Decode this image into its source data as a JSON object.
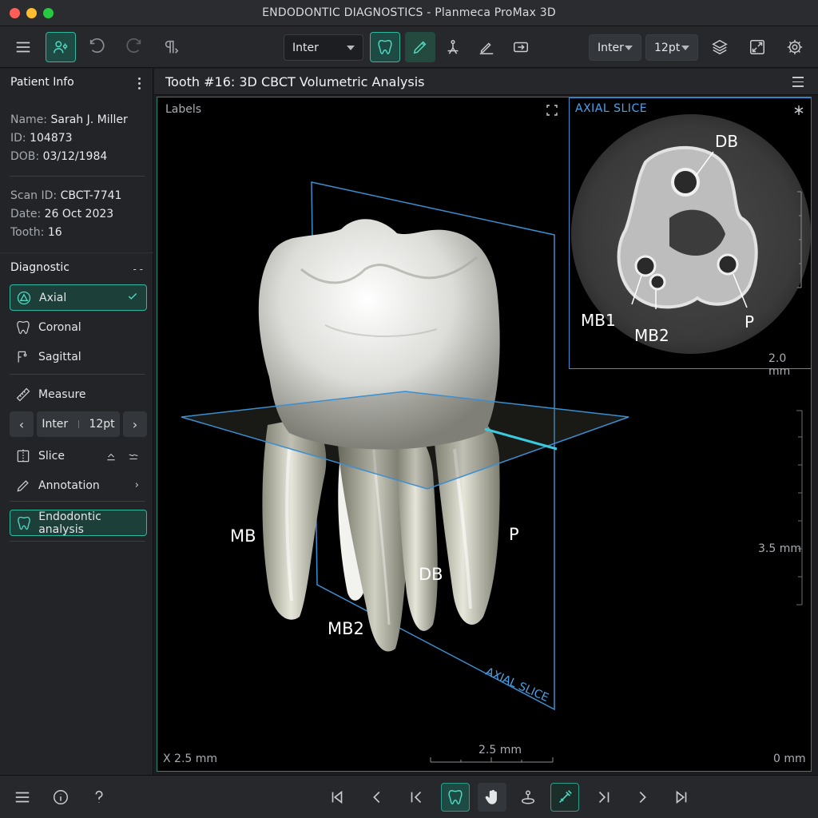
{
  "window": {
    "title": "ENDODONTIC DIAGNOSTICS - Planmeca ProMax 3D"
  },
  "toolbar": {
    "font_select": "Inter",
    "right_font": "Inter",
    "right_size": "12pt"
  },
  "patient": {
    "section_title": "Patient Info",
    "name_label": "Name:",
    "name": "Sarah J. Miller",
    "id_label": "ID:",
    "id": "104873",
    "dob_label": "DOB:",
    "dob": "03/12/1984",
    "scan_label": "Scan ID:",
    "scan_id": "CBCT-7741",
    "date_label": "Date:",
    "date": "26 Oct 2023",
    "tooth_label": "Tooth:",
    "tooth": "16"
  },
  "diagnostic": {
    "section_title": "Diagnostic",
    "axial": "Axial",
    "coronal": "Coronal",
    "sagittal": "Sagittal",
    "measure": "Measure",
    "stepper_font": "Inter",
    "stepper_size": "12pt",
    "slice": "Slice",
    "annotation": "Annotation",
    "endodontic": "Endodontic analysis"
  },
  "main": {
    "title": "Tooth #16: 3D CBCT Volumetric Analysis",
    "labels_toggle": "Labels",
    "roots": {
      "mb": "MB",
      "mb2": "MB2",
      "db": "DB",
      "p": "P"
    },
    "plane_label": "AXIAL SLICE",
    "scale_x": "X 2.5 mm",
    "scale_bar": "2.5 mm",
    "scale_zero": "0 mm",
    "scale_vertical": "3.5 mm"
  },
  "inset": {
    "title": "AXIAL SLICE",
    "canals": {
      "db": "DB",
      "mb1": "MB1",
      "mb2": "MB2",
      "p": "P"
    },
    "scale": "2.0 mm"
  },
  "colors": {
    "accent": "#2fb8a0",
    "plane": "#3a8fd1",
    "background": "#1b1d20"
  }
}
